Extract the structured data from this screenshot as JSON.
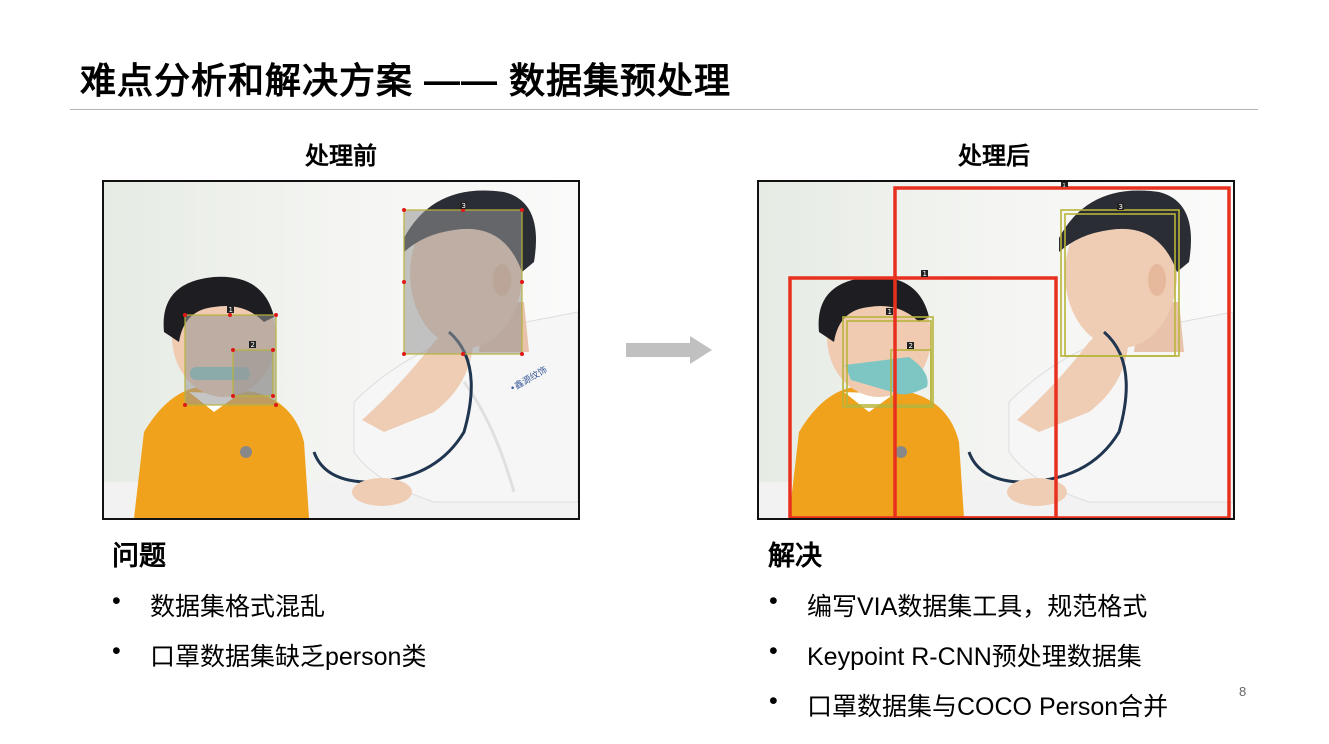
{
  "slide": {
    "title": "难点分析和解决方案 —— 数据集预处理",
    "page_number": "8"
  },
  "before": {
    "caption": "处理前",
    "box_labels": [
      "1",
      "2",
      "3"
    ]
  },
  "after": {
    "caption": "处理后",
    "box_labels": [
      "1",
      "2",
      "3",
      "1",
      "1"
    ]
  },
  "photo": {
    "coat_text": "•鑫源纹饰"
  },
  "problem": {
    "heading": "问题",
    "bullet_char": "•",
    "items": [
      "数据集格式混乱",
      "口罩数据集缺乏person类"
    ]
  },
  "solution": {
    "heading": "解决",
    "bullet_char": "•",
    "items": [
      "编写VIA数据集工具，规范格式",
      "Keypoint R-CNN预处理数据集",
      "口罩数据集与COCO Person合并"
    ]
  },
  "colors": {
    "annotation_box_yellow": "#b8b43a",
    "person_box_red": "#e8301e",
    "arrow_gray": "#c0c0c0",
    "shirt_yellow": "#f0a21c"
  }
}
